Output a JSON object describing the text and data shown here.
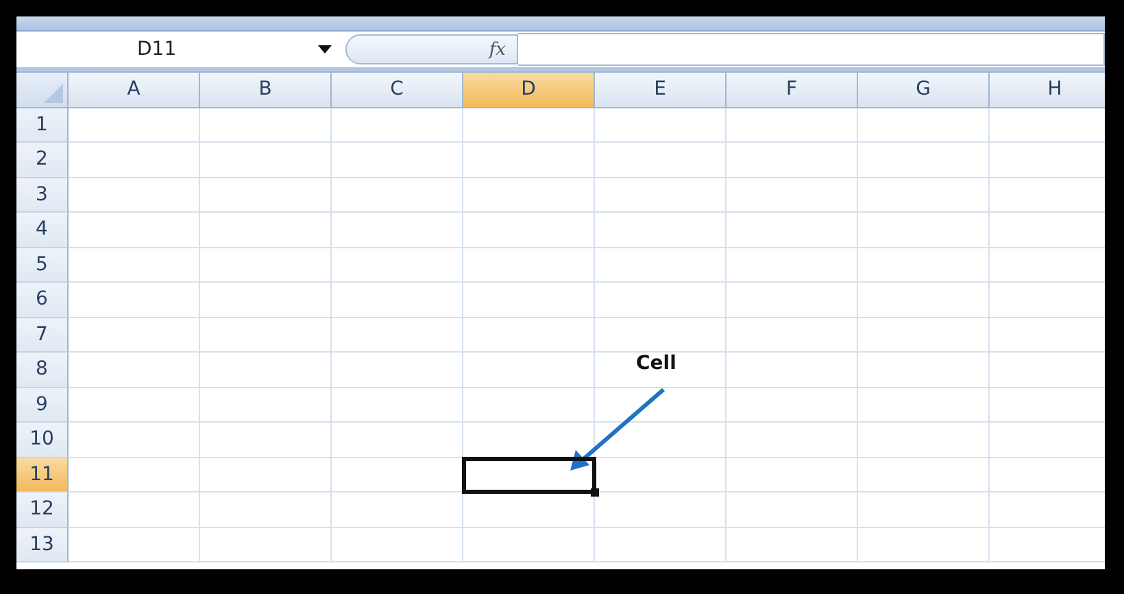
{
  "name_box": {
    "value": "D11"
  },
  "formula_bar": {
    "function_label": "fx"
  },
  "columns": [
    {
      "label": "A",
      "selected": false
    },
    {
      "label": "B",
      "selected": false
    },
    {
      "label": "C",
      "selected": false
    },
    {
      "label": "D",
      "selected": true
    },
    {
      "label": "E",
      "selected": false
    },
    {
      "label": "F",
      "selected": false
    },
    {
      "label": "G",
      "selected": false
    },
    {
      "label": "H",
      "selected": false
    }
  ],
  "rows": [
    {
      "label": "1",
      "selected": false
    },
    {
      "label": "2",
      "selected": false
    },
    {
      "label": "3",
      "selected": false
    },
    {
      "label": "4",
      "selected": false
    },
    {
      "label": "5",
      "selected": false
    },
    {
      "label": "6",
      "selected": false
    },
    {
      "label": "7",
      "selected": false
    },
    {
      "label": "8",
      "selected": false
    },
    {
      "label": "9",
      "selected": false
    },
    {
      "label": "10",
      "selected": false
    },
    {
      "label": "11",
      "selected": true
    },
    {
      "label": "12",
      "selected": false
    },
    {
      "label": "13",
      "selected": false
    }
  ],
  "annotation": {
    "label": "Cell"
  }
}
